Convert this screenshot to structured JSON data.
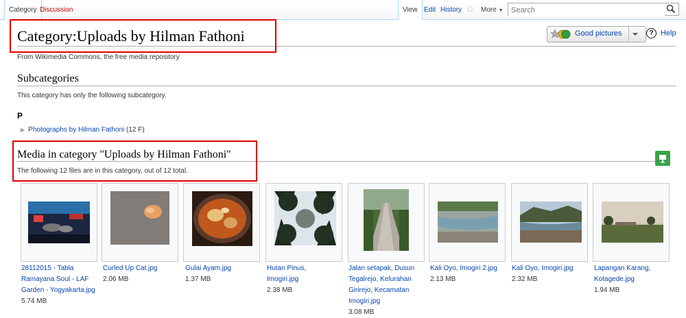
{
  "tabs": {
    "category": "Category",
    "discussion": "Discussion",
    "view": "View",
    "edit": "Edit",
    "history": "History",
    "more": "More"
  },
  "search": {
    "placeholder": "Search"
  },
  "page": {
    "title": "Category:Uploads by Hilman Fathoni",
    "tagline": "From Wikimedia Commons, the free media repository",
    "good_pictures": "Good pictures",
    "help": "Help"
  },
  "subcategories": {
    "heading": "Subcategories",
    "intro": "This category has only the following subcategory.",
    "letter": "P",
    "item_label": "Photographs by Hilman Fathoni",
    "item_count": "(12 F)"
  },
  "media": {
    "heading": "Media in category \"Uploads by Hilman Fathoni\"",
    "intro": "The following 12 files are in this category, out of 12 total.",
    "files": [
      {
        "name": "28112015 - Tabla Ramayana Soul - LAF Garden - Yogyakarta.jpg",
        "size": "5.74 MB"
      },
      {
        "name": "Curled Up Cat.jpg",
        "size": "2.06 MB"
      },
      {
        "name": "Gulai Ayam.jpg",
        "size": "1.37 MB"
      },
      {
        "name": "Hutan Pinus, Imogiri.jpg",
        "size": "2.38 MB"
      },
      {
        "name": "Jalan setapak, Dusun Tegalrejo, Kelurahan Girirejo, Kecamatan Imogiri.jpg",
        "size": "3.08 MB"
      },
      {
        "name": "Kali Oyo, Imogiri 2.jpg",
        "size": "2.13 MB"
      },
      {
        "name": "Kali Oyo, Imogiri.jpg",
        "size": "2.32 MB"
      },
      {
        "name": "Lapangan Karang, Kotagede.jpg",
        "size": "1.94 MB"
      }
    ]
  },
  "colors": {
    "link": "#0645ad",
    "highlight_box": "#e00000",
    "slideshow_button": "#3aa34a"
  }
}
